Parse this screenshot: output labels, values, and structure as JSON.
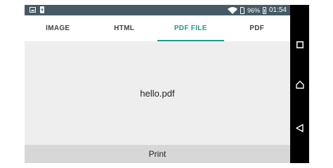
{
  "status_bar": {
    "battery_percent": "96%",
    "time": "01:54",
    "icons": [
      "image-icon",
      "battery-charging-icon",
      "wifi-icon",
      "sim-icon",
      "battery-icon"
    ]
  },
  "tabs": [
    {
      "label": "IMAGE",
      "active": false
    },
    {
      "label": "HTML",
      "active": false
    },
    {
      "label": "PDF FILE",
      "active": true
    },
    {
      "label": "PDF",
      "active": false
    }
  ],
  "content": {
    "file_name": "hello.pdf"
  },
  "actions": {
    "print_label": "Print"
  },
  "navigation": {
    "buttons": [
      "recents-icon",
      "home-icon",
      "back-icon"
    ]
  },
  "colors": {
    "status_bar": "#455a64",
    "accent": "#1e9c8c",
    "background": "#eeeeee",
    "print_button": "#d7d7d7"
  }
}
